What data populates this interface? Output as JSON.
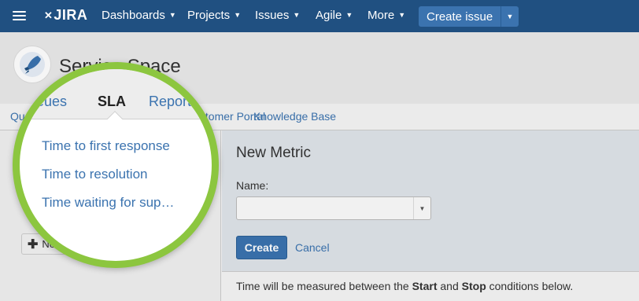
{
  "topnav": {
    "logo": "JIRA",
    "items": [
      "Dashboards",
      "Projects",
      "Issues",
      "Agile",
      "More"
    ],
    "create_issue": "Create issue"
  },
  "project": {
    "title": "Service Space"
  },
  "subnav": {
    "items": [
      "Queues",
      "SLA",
      "Reports",
      "Customer Portal",
      "Knowledge Base"
    ]
  },
  "sla_list": {
    "items": [
      "Time to first response",
      "Time to resolution",
      "Time waiting for sup…"
    ],
    "new_button": "New"
  },
  "new_metric": {
    "title": "New Metric",
    "name_label": "Name:",
    "name_value": "",
    "create_button": "Create",
    "cancel_link": "Cancel"
  },
  "footer": {
    "prefix": "Time will be measured between the ",
    "start": "Start",
    "middle": " and ",
    "stop": "Stop",
    "suffix": " conditions below."
  },
  "colors": {
    "nav_bg": "#205081",
    "accent": "#3b73af",
    "magnifier_ring": "#8cc63f"
  }
}
